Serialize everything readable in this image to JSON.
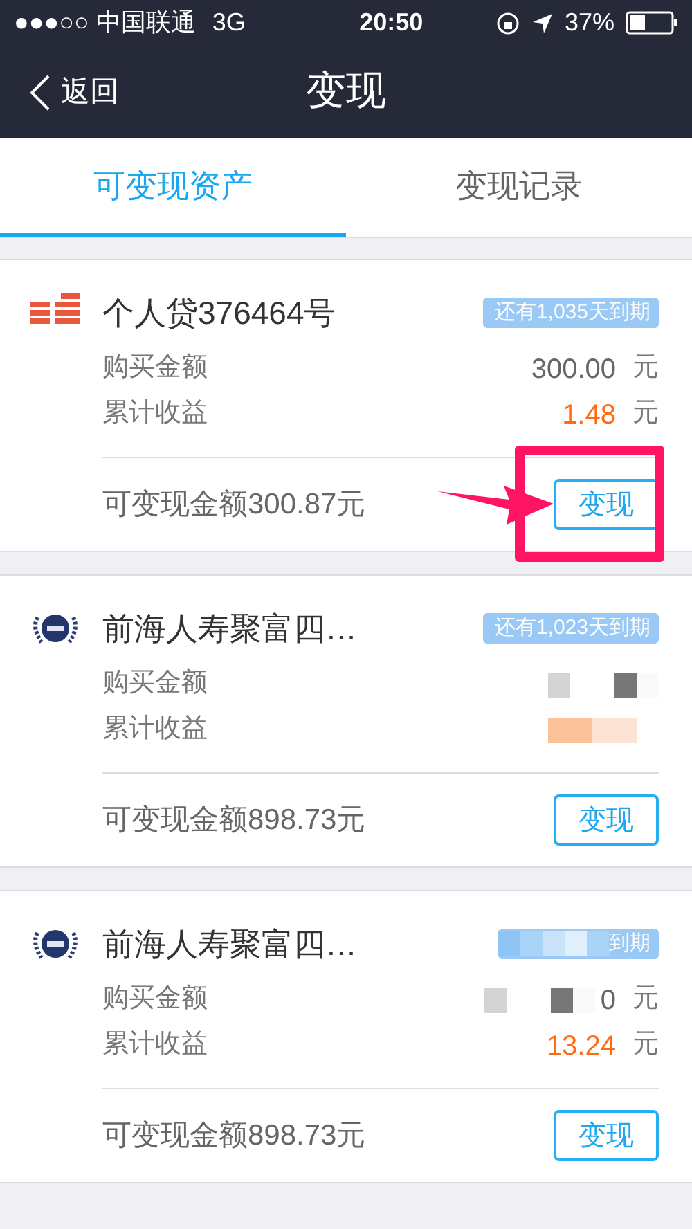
{
  "status_bar": {
    "carrier": "●●●○○ 中国联通",
    "network": "3G",
    "time": "20:50",
    "battery": "37%"
  },
  "nav": {
    "back": "返回",
    "title": "变现"
  },
  "tabs": [
    {
      "label": "可变现资产",
      "selected": true
    },
    {
      "label": "变现记录",
      "selected": false
    }
  ],
  "cards": [
    {
      "kind": "stack",
      "title": "个人贷376464号",
      "badge": {
        "text": "还有1,035天到期",
        "redacted": false
      },
      "purchase": {
        "label": "购买金额",
        "value": "300.00",
        "unit": "元",
        "redacted": false
      },
      "earnings": {
        "label": "累计收益",
        "value": "1.48",
        "unit": "元",
        "redacted": false
      },
      "available": "可变现金额300.87元",
      "button": "变现",
      "highlighted": true
    },
    {
      "kind": "emblem",
      "title": "前海人寿聚富四…",
      "badge": {
        "text": "还有1,023天到期",
        "redacted": false
      },
      "purchase": {
        "label": "购买金额",
        "redacted": true
      },
      "earnings": {
        "label": "累计收益",
        "redacted": true
      },
      "available": "可变现金额898.73元",
      "button": "变现",
      "highlighted": false
    },
    {
      "kind": "emblem",
      "title": "前海人寿聚富四…",
      "badge": {
        "text": "到期",
        "redacted": true
      },
      "purchase": {
        "label": "购买金额",
        "value": "0",
        "unit": "元",
        "redacted": true
      },
      "earnings": {
        "label": "累计收益",
        "value": "13.24",
        "unit": "元",
        "redacted": false
      },
      "available": "可变现金额898.73元",
      "button": "变现",
      "highlighted": false
    }
  ]
}
